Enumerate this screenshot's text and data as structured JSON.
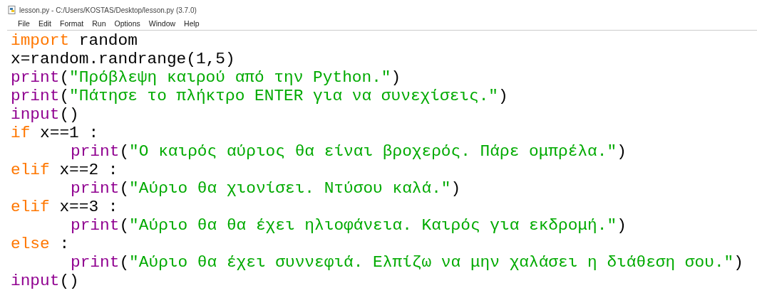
{
  "window": {
    "title": "lesson.py - C:/Users/KOSTAS/Desktop/lesson.py (3.7.0)"
  },
  "menu": [
    "File",
    "Edit",
    "Format",
    "Run",
    "Options",
    "Window",
    "Help"
  ],
  "code": [
    {
      "tokens": [
        {
          "kind": "keyword",
          "text": "import"
        },
        {
          "kind": "plain",
          "text": " random"
        }
      ]
    },
    {
      "tokens": [
        {
          "kind": "plain",
          "text": "x=random.randrange(1,5)"
        }
      ]
    },
    {
      "tokens": [
        {
          "kind": "builtin",
          "text": "print"
        },
        {
          "kind": "plain",
          "text": "("
        },
        {
          "kind": "string",
          "text": "\"Πρόβλεψη καιρού από την Python.\""
        },
        {
          "kind": "plain",
          "text": ")"
        }
      ]
    },
    {
      "tokens": [
        {
          "kind": "builtin",
          "text": "print"
        },
        {
          "kind": "plain",
          "text": "("
        },
        {
          "kind": "string",
          "text": "\"Πάτησε το πλήκτρο ENTER για να συνεχίσεις.\""
        },
        {
          "kind": "plain",
          "text": ")"
        }
      ]
    },
    {
      "tokens": [
        {
          "kind": "builtin",
          "text": "input"
        },
        {
          "kind": "plain",
          "text": "()"
        }
      ]
    },
    {
      "tokens": [
        {
          "kind": "keyword",
          "text": "if"
        },
        {
          "kind": "plain",
          "text": " x==1 :"
        }
      ],
      "children": [
        {
          "tokens": [
            {
              "kind": "builtin",
              "text": "print"
            },
            {
              "kind": "plain",
              "text": "("
            },
            {
              "kind": "string",
              "text": "\"Ο καιρός αύριος θα είναι βροχερός. Πάρε ομπρέλα.\""
            },
            {
              "kind": "plain",
              "text": ")"
            }
          ]
        }
      ]
    },
    {
      "tokens": [
        {
          "kind": "keyword",
          "text": "elif"
        },
        {
          "kind": "plain",
          "text": " x==2 :"
        }
      ],
      "children": [
        {
          "tokens": [
            {
              "kind": "builtin",
              "text": "print"
            },
            {
              "kind": "plain",
              "text": "("
            },
            {
              "kind": "string",
              "text": "\"Αύριο θα χιονίσει. Ντύσου καλά.\""
            },
            {
              "kind": "plain",
              "text": ")"
            }
          ]
        }
      ]
    },
    {
      "tokens": [
        {
          "kind": "keyword",
          "text": "elif"
        },
        {
          "kind": "plain",
          "text": " x==3 :"
        }
      ],
      "children": [
        {
          "tokens": [
            {
              "kind": "builtin",
              "text": "print"
            },
            {
              "kind": "plain",
              "text": "("
            },
            {
              "kind": "string",
              "text": "\"Αύριο θα θα έχει ηλιοφάνεια. Καιρός για εκδρομή.\""
            },
            {
              "kind": "plain",
              "text": ")"
            }
          ]
        }
      ]
    },
    {
      "tokens": [
        {
          "kind": "keyword",
          "text": "else"
        },
        {
          "kind": "plain",
          "text": " :"
        }
      ],
      "children": [
        {
          "tokens": [
            {
              "kind": "builtin",
              "text": "print"
            },
            {
              "kind": "plain",
              "text": "("
            },
            {
              "kind": "string",
              "text": "\"Αύριο θα έχει συννεφιά. Ελπίζω να μην χαλάσει η διάθεση σου.\""
            },
            {
              "kind": "plain",
              "text": ")"
            }
          ]
        }
      ]
    },
    {
      "tokens": [
        {
          "kind": "builtin",
          "text": "input"
        },
        {
          "kind": "plain",
          "text": "()"
        }
      ]
    }
  ]
}
